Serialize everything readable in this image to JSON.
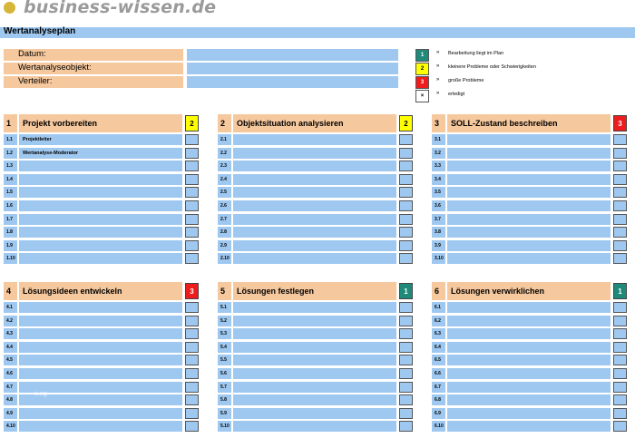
{
  "logo": {
    "text": "business-wissen.de"
  },
  "title": "Wertanalyseplan",
  "header_fields": [
    {
      "label": "Datum:"
    },
    {
      "label": "Wertanalyseobjekt:"
    },
    {
      "label": "Verteiler:"
    }
  ],
  "legend": [
    {
      "symbol": "1",
      "arrow": "»",
      "text": "Bearbeitung liegt im Plan"
    },
    {
      "symbol": "2",
      "arrow": "»",
      "text": "kleinere Probleme oder Schwierigkeiten"
    },
    {
      "symbol": "3",
      "arrow": "»",
      "text": "große Probleme"
    },
    {
      "symbol": "×",
      "arrow": "»",
      "text": "erledigt"
    }
  ],
  "panels": [
    {
      "num": "1",
      "title": "Projekt vorbereiten",
      "status": "2",
      "rows": [
        {
          "id": "1.1",
          "text": "Projektleiter"
        },
        {
          "id": "1.2",
          "text": "Wertanalyse-Moderator"
        },
        {
          "id": "1.3",
          "text": ""
        },
        {
          "id": "1.4",
          "text": ""
        },
        {
          "id": "1.5",
          "text": ""
        },
        {
          "id": "1.6",
          "text": ""
        },
        {
          "id": "1.7",
          "text": ""
        },
        {
          "id": "1.8",
          "text": ""
        },
        {
          "id": "1.9",
          "text": ""
        },
        {
          "id": "1.10",
          "text": ""
        }
      ]
    },
    {
      "num": "2",
      "title": "Objektsituation analysieren",
      "status": "2",
      "rows": [
        {
          "id": "2.1",
          "text": ""
        },
        {
          "id": "2.2",
          "text": ""
        },
        {
          "id": "2.3",
          "text": ""
        },
        {
          "id": "2.4",
          "text": ""
        },
        {
          "id": "2.5",
          "text": ""
        },
        {
          "id": "2.6",
          "text": ""
        },
        {
          "id": "2.7",
          "text": ""
        },
        {
          "id": "2.8",
          "text": ""
        },
        {
          "id": "2.9",
          "text": ""
        },
        {
          "id": "2.10",
          "text": ""
        }
      ]
    },
    {
      "num": "3",
      "title": "SOLL-Zustand beschreiben",
      "status": "3",
      "rows": [
        {
          "id": "3.1",
          "text": ""
        },
        {
          "id": "3.2",
          "text": ""
        },
        {
          "id": "3.3",
          "text": ""
        },
        {
          "id": "3.4",
          "text": ""
        },
        {
          "id": "3.5",
          "text": ""
        },
        {
          "id": "3.6",
          "text": ""
        },
        {
          "id": "3.7",
          "text": ""
        },
        {
          "id": "3.8",
          "text": ""
        },
        {
          "id": "3.9",
          "text": ""
        },
        {
          "id": "3.10",
          "text": ""
        }
      ]
    },
    {
      "num": "4",
      "title": "Lösungsideen entwickeln",
      "status": "3",
      "rows": [
        {
          "id": "4.1",
          "text": ""
        },
        {
          "id": "4.2",
          "text": ""
        },
        {
          "id": "4.3",
          "text": ""
        },
        {
          "id": "4.4",
          "text": ""
        },
        {
          "id": "4.5",
          "text": ""
        },
        {
          "id": "4.6",
          "text": ""
        },
        {
          "id": "4.7",
          "text": ""
        },
        {
          "id": "4.8",
          "text": ""
        },
        {
          "id": "4.9",
          "text": ""
        },
        {
          "id": "4.10",
          "text": ""
        }
      ]
    },
    {
      "num": "5",
      "title": "Lösungen festlegen",
      "status": "1",
      "rows": [
        {
          "id": "5.1",
          "text": ""
        },
        {
          "id": "5.2",
          "text": ""
        },
        {
          "id": "5.3",
          "text": ""
        },
        {
          "id": "5.4",
          "text": ""
        },
        {
          "id": "5.5",
          "text": ""
        },
        {
          "id": "5.6",
          "text": ""
        },
        {
          "id": "5.7",
          "text": ""
        },
        {
          "id": "5.8",
          "text": ""
        },
        {
          "id": "5.9",
          "text": ""
        },
        {
          "id": "5.10",
          "text": ""
        }
      ]
    },
    {
      "num": "6",
      "title": "Lösungen verwirklichen",
      "status": "1",
      "rows": [
        {
          "id": "6.1",
          "text": ""
        },
        {
          "id": "6.2",
          "text": ""
        },
        {
          "id": "6.3",
          "text": ""
        },
        {
          "id": "6.4",
          "text": ""
        },
        {
          "id": "6.5",
          "text": ""
        },
        {
          "id": "6.6",
          "text": ""
        },
        {
          "id": "6.7",
          "text": ""
        },
        {
          "id": "6.8",
          "text": ""
        },
        {
          "id": "6.9",
          "text": ""
        },
        {
          "id": "6.10",
          "text": ""
        }
      ]
    }
  ],
  "watermark": "a.ug",
  "colors": {
    "label_bg": "#f6c89d",
    "field_bg": "#9fc8f0",
    "status_1": "#1f8a7a",
    "status_2": "#ffff00",
    "status_3": "#ee1c1c"
  }
}
